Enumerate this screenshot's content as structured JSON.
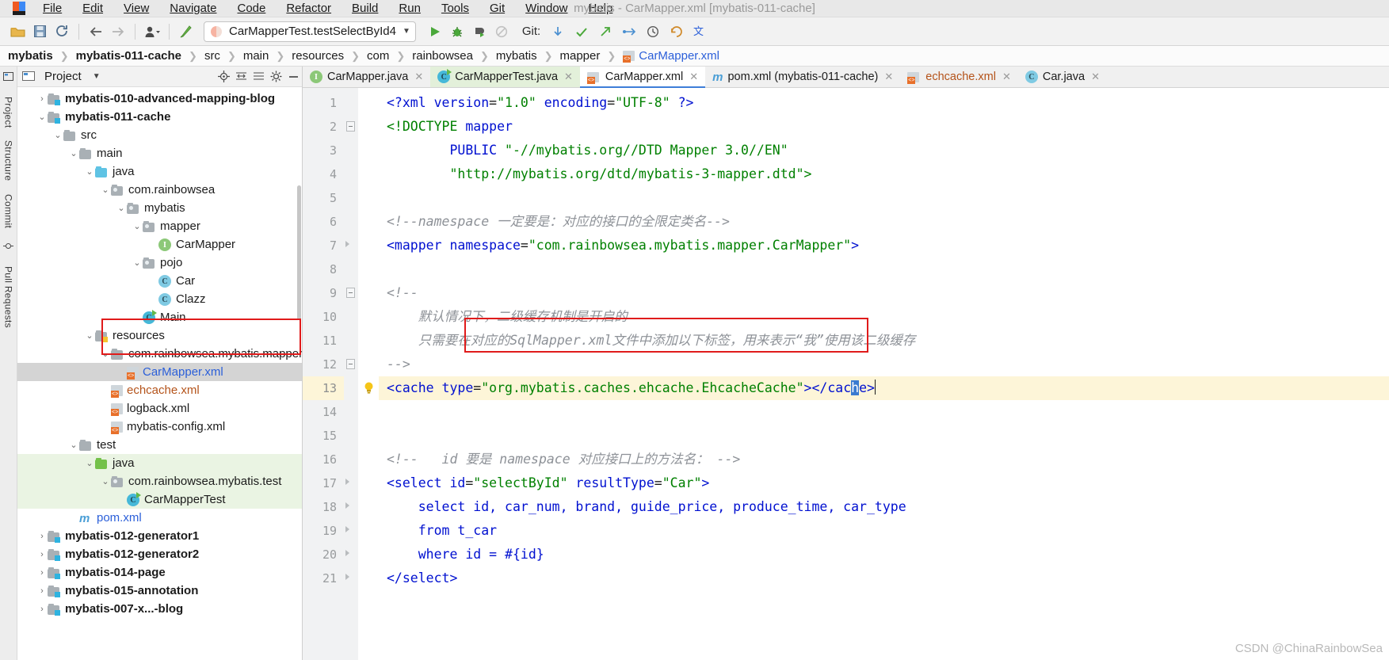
{
  "window": {
    "title": "mybatis - CarMapper.xml [mybatis-011-cache]",
    "logo_icon": "intellij-idea-logo"
  },
  "menu": [
    {
      "label": "File"
    },
    {
      "label": "Edit"
    },
    {
      "label": "View"
    },
    {
      "label": "Navigate"
    },
    {
      "label": "Code"
    },
    {
      "label": "Refactor"
    },
    {
      "label": "Build"
    },
    {
      "label": "Run"
    },
    {
      "label": "Tools"
    },
    {
      "label": "Git"
    },
    {
      "label": "Window"
    },
    {
      "label": "Help"
    }
  ],
  "toolbar": {
    "icons": [
      "open-project-icon",
      "save-all-icon",
      "sync-refresh-icon",
      "navigate-back-icon",
      "navigate-forward-icon",
      "profile-user-icon",
      "build-hammer-icon"
    ],
    "run_config": {
      "value": "CarMapperTest.testSelectById4",
      "icon": "run-config-icon",
      "dropdown_icon": "chevron-down-icon"
    },
    "run_icon": "run-play-icon",
    "debug_icon": "debug-bug-icon",
    "run-coverage_icon": "run-with-coverage-icon",
    "stop_icon": "stop-disabled-icon",
    "git": {
      "label": "Git:",
      "update_icon": "git-update-icon",
      "commit_icon": "git-commit-check-icon",
      "push_icon": "git-push-icon",
      "branch_icon": "git-branch-icon",
      "history_icon": "git-history-clock-icon",
      "rollback_icon": "git-rollback-icon",
      "translate_icon": "translate-icon"
    }
  },
  "breadcrumb": {
    "items": [
      {
        "label": "mybatis",
        "bold": true
      },
      {
        "label": "mybatis-011-cache",
        "bold": true
      },
      {
        "label": "src"
      },
      {
        "label": "main"
      },
      {
        "label": "resources"
      },
      {
        "label": "com"
      },
      {
        "label": "rainbowsea"
      },
      {
        "label": "mybatis"
      },
      {
        "label": "mapper"
      },
      {
        "label": "CarMapper.xml",
        "file": true
      }
    ],
    "separator": "❯"
  },
  "left_rail": {
    "items": [
      {
        "label": "Project",
        "icon": "project-tool-icon"
      },
      {
        "label": "Structure",
        "icon": "structure-tool-icon"
      },
      {
        "label": "Commit",
        "icon": "commit-tool-icon"
      },
      {
        "label": "Pull Requests",
        "icon": "pull-requests-tool-icon"
      }
    ]
  },
  "project_panel": {
    "header": {
      "icon": "project-panel-icon",
      "title": "Project",
      "dropdown_icon": "chevron-down-icon",
      "buttons": [
        "locate-target-icon",
        "collapse-horizontal-icon",
        "collapse-all-icon",
        "settings-gear-icon",
        "hide-minimize-icon"
      ]
    },
    "tree": [
      {
        "depth": 1,
        "arrow": "collapsed",
        "icon": "module-folder-icon",
        "label": "mybatis-010-advanced-mapping-blog",
        "bold": true
      },
      {
        "depth": 1,
        "arrow": "expanded",
        "icon": "module-folder-icon",
        "label": "mybatis-011-cache",
        "bold": true
      },
      {
        "depth": 2,
        "arrow": "expanded",
        "icon": "folder-icon",
        "label": "src"
      },
      {
        "depth": 3,
        "arrow": "expanded",
        "icon": "folder-icon",
        "label": "main"
      },
      {
        "depth": 4,
        "arrow": "expanded",
        "icon": "source-folder-icon",
        "label": "java"
      },
      {
        "depth": 5,
        "arrow": "expanded",
        "icon": "package-icon",
        "label": "com.rainbowsea"
      },
      {
        "depth": 6,
        "arrow": "expanded",
        "icon": "package-icon",
        "label": "mybatis"
      },
      {
        "depth": 7,
        "arrow": "expanded",
        "icon": "package-icon",
        "label": "mapper"
      },
      {
        "depth": 8,
        "arrow": "none",
        "icon": "interface-icon",
        "label": "CarMapper"
      },
      {
        "depth": 7,
        "arrow": "expanded",
        "icon": "package-icon",
        "label": "pojo"
      },
      {
        "depth": 8,
        "arrow": "none",
        "icon": "class-icon",
        "label": "Car"
      },
      {
        "depth": 8,
        "arrow": "none",
        "icon": "class-icon",
        "label": "Clazz"
      },
      {
        "depth": 7,
        "arrow": "none",
        "icon": "runnable-class-icon",
        "label": "Main"
      },
      {
        "depth": 4,
        "arrow": "expanded",
        "icon": "resource-folder-icon",
        "label": "resources"
      },
      {
        "depth": 5,
        "arrow": "expanded",
        "icon": "folder-icon",
        "label": "com.rainbowsea.mybatis.mapper"
      },
      {
        "depth": 6,
        "arrow": "none",
        "icon": "xml-file-icon",
        "label": "CarMapper.xml",
        "color": "blue",
        "selected": true
      },
      {
        "depth": 5,
        "arrow": "none",
        "icon": "xml-file-icon",
        "label": "echcache.xml",
        "color": "orange"
      },
      {
        "depth": 5,
        "arrow": "none",
        "icon": "xml-file-icon",
        "label": "logback.xml"
      },
      {
        "depth": 5,
        "arrow": "none",
        "icon": "xml-file-icon",
        "label": "mybatis-config.xml"
      },
      {
        "depth": 3,
        "arrow": "expanded",
        "icon": "folder-icon",
        "label": "test"
      },
      {
        "depth": 4,
        "arrow": "expanded",
        "icon": "test-source-folder-icon",
        "label": "java",
        "test_scope": true
      },
      {
        "depth": 5,
        "arrow": "expanded",
        "icon": "package-icon",
        "label": "com.rainbowsea.mybatis.test",
        "test_scope": true
      },
      {
        "depth": 6,
        "arrow": "none",
        "icon": "runnable-class-icon",
        "label": "CarMapperTest",
        "test_scope": true
      },
      {
        "depth": 3,
        "arrow": "none",
        "icon": "maven-pom-icon",
        "label": "pom.xml",
        "color": "blue"
      },
      {
        "depth": 1,
        "arrow": "collapsed",
        "icon": "module-folder-icon",
        "label": "mybatis-012-generator1",
        "bold": true
      },
      {
        "depth": 1,
        "arrow": "collapsed",
        "icon": "module-folder-icon",
        "label": "mybatis-012-generator2",
        "bold": true
      },
      {
        "depth": 1,
        "arrow": "collapsed",
        "icon": "module-folder-icon",
        "label": "mybatis-014-page",
        "bold": true
      },
      {
        "depth": 1,
        "arrow": "collapsed",
        "icon": "module-folder-icon",
        "label": "mybatis-015-annotation",
        "bold": true
      },
      {
        "depth": 1,
        "arrow": "collapsed",
        "icon": "module-folder-icon",
        "label": "mybatis-007-x...-blog",
        "bold": true
      }
    ]
  },
  "editor_tabs": [
    {
      "label": "CarMapper.java",
      "icon": "interface-icon",
      "state": "normal"
    },
    {
      "label": "CarMapperTest.java",
      "icon": "runnable-class-icon",
      "state": "test"
    },
    {
      "label": "CarMapper.xml",
      "icon": "xml-file-icon",
      "state": "active",
      "color": "orange"
    },
    {
      "label": "pom.xml (mybatis-011-cache)",
      "icon": "maven-pom-icon",
      "state": "normal"
    },
    {
      "label": "echcache.xml",
      "icon": "xml-file-icon",
      "state": "normal",
      "color": "orange"
    },
    {
      "label": "Car.java",
      "icon": "class-icon",
      "state": "normal"
    }
  ],
  "editor": {
    "line_numbers": [
      "1",
      "2",
      "3",
      "4",
      "5",
      "6",
      "7",
      "8",
      "9",
      "10",
      "11",
      "12",
      "13",
      "14",
      "15",
      "16",
      "17",
      "18",
      "19",
      "20",
      "21"
    ],
    "highlighted_line": "13",
    "lines": [
      {
        "n": "1",
        "segments": [
          {
            "t": "<?",
            "c": "tag"
          },
          {
            "t": "xml",
            "c": "kw"
          },
          {
            "t": " ",
            "c": "plain"
          },
          {
            "t": "version",
            "c": "attr"
          },
          {
            "t": "=",
            "c": "plain"
          },
          {
            "t": "\"1.0\"",
            "c": "str"
          },
          {
            "t": " ",
            "c": "plain"
          },
          {
            "t": "encoding",
            "c": "attr"
          },
          {
            "t": "=",
            "c": "plain"
          },
          {
            "t": "\"UTF-8\"",
            "c": "str"
          },
          {
            "t": " ",
            "c": "plain"
          },
          {
            "t": "?>",
            "c": "tag"
          }
        ]
      },
      {
        "n": "2",
        "segments": [
          {
            "t": "<!DOCTYPE",
            "c": "doc"
          },
          {
            "t": " ",
            "c": "plain"
          },
          {
            "t": "mapper",
            "c": "kw"
          }
        ]
      },
      {
        "n": "3",
        "segments": [
          {
            "t": "        ",
            "c": "plain"
          },
          {
            "t": "PUBLIC",
            "c": "kw"
          },
          {
            "t": " ",
            "c": "plain"
          },
          {
            "t": "\"-//mybatis.org//DTD Mapper 3.0//EN\"",
            "c": "str"
          }
        ]
      },
      {
        "n": "4",
        "segments": [
          {
            "t": "        ",
            "c": "plain"
          },
          {
            "t": "\"http://mybatis.org/dtd/mybatis-3-mapper.dtd\">",
            "c": "str"
          }
        ]
      },
      {
        "n": "5",
        "segments": []
      },
      {
        "n": "6",
        "segments": [
          {
            "t": "<!--namespace 一定要是：对应的接口的全限定类名-->",
            "c": "cmt"
          }
        ]
      },
      {
        "n": "7",
        "segments": [
          {
            "t": "<mapper",
            "c": "tag"
          },
          {
            "t": " ",
            "c": "plain"
          },
          {
            "t": "namespace",
            "c": "attr"
          },
          {
            "t": "=",
            "c": "plain"
          },
          {
            "t": "\"com.rainbowsea.mybatis.mapper.CarMapper\"",
            "c": "str"
          },
          {
            "t": ">",
            "c": "tag"
          }
        ]
      },
      {
        "n": "8",
        "segments": []
      },
      {
        "n": "9",
        "segments": [
          {
            "t": "<!--",
            "c": "cmt"
          }
        ]
      },
      {
        "n": "10",
        "segments": [
          {
            "t": "    默认情况下，二级缓存机制是开启的",
            "c": "cmt"
          }
        ]
      },
      {
        "n": "11",
        "segments": [
          {
            "t": "    只需要在对应的SqlMapper.xml文件中添加以下标签，用来表示“我”使用该二级缓存",
            "c": "cmt"
          }
        ]
      },
      {
        "n": "12",
        "segments": [
          {
            "t": "-->",
            "c": "cmt"
          }
        ]
      },
      {
        "n": "13",
        "segments": [
          {
            "t": "<cache",
            "c": "tag"
          },
          {
            "t": " ",
            "c": "plain"
          },
          {
            "t": "type",
            "c": "attr"
          },
          {
            "t": "=",
            "c": "plain"
          },
          {
            "t": "\"org.mybatis.caches.ehcache.EhcacheCache\"",
            "c": "str"
          },
          {
            "t": ">",
            "c": "tag"
          },
          {
            "t": "</cac",
            "c": "tag"
          },
          {
            "t": "h",
            "c": "sel"
          },
          {
            "t": "e>",
            "c": "tag"
          }
        ]
      },
      {
        "n": "14",
        "segments": []
      },
      {
        "n": "15",
        "segments": []
      },
      {
        "n": "16",
        "segments": [
          {
            "t": "<!--   id 要是 namespace 对应接口上的方法名： -->",
            "c": "cmt"
          }
        ]
      },
      {
        "n": "17",
        "segments": [
          {
            "t": "<select",
            "c": "tag"
          },
          {
            "t": " ",
            "c": "plain"
          },
          {
            "t": "id",
            "c": "attr"
          },
          {
            "t": "=",
            "c": "plain"
          },
          {
            "t": "\"selectById\"",
            "c": "str"
          },
          {
            "t": " ",
            "c": "plain"
          },
          {
            "t": "resultType",
            "c": "attr"
          },
          {
            "t": "=",
            "c": "plain"
          },
          {
            "t": "\"Car\"",
            "c": "str"
          },
          {
            "t": ">",
            "c": "tag"
          }
        ]
      },
      {
        "n": "18",
        "segments": [
          {
            "t": "    ",
            "c": "plain"
          },
          {
            "t": "select",
            "c": "sql"
          },
          {
            "t": " id, car_num, brand, guide_price, produce_time, car_type",
            "c": "sql"
          }
        ]
      },
      {
        "n": "19",
        "segments": [
          {
            "t": "    ",
            "c": "plain"
          },
          {
            "t": "from",
            "c": "sql"
          },
          {
            "t": " t_car",
            "c": "sql"
          }
        ]
      },
      {
        "n": "20",
        "segments": [
          {
            "t": "    ",
            "c": "plain"
          },
          {
            "t": "where",
            "c": "sql"
          },
          {
            "t": " id = ",
            "c": "sql"
          },
          {
            "t": "#{id}",
            "c": "sql"
          }
        ]
      },
      {
        "n": "21",
        "segments": [
          {
            "t": "</select>",
            "c": "tag"
          }
        ]
      }
    ],
    "intention_bulb_icon": "intention-lightbulb-icon"
  },
  "watermark": "CSDN @ChinaRainbowSea",
  "colors": {
    "tag": "#0010d0",
    "string": "#008000",
    "comment": "#8d9197",
    "highlight_line": "#fdf5d8",
    "selection": "#3a7bd0",
    "annotation_box": "#e01b1b",
    "accent": "#3e7ed8",
    "test_scope_bg": "#eaf4e3"
  }
}
